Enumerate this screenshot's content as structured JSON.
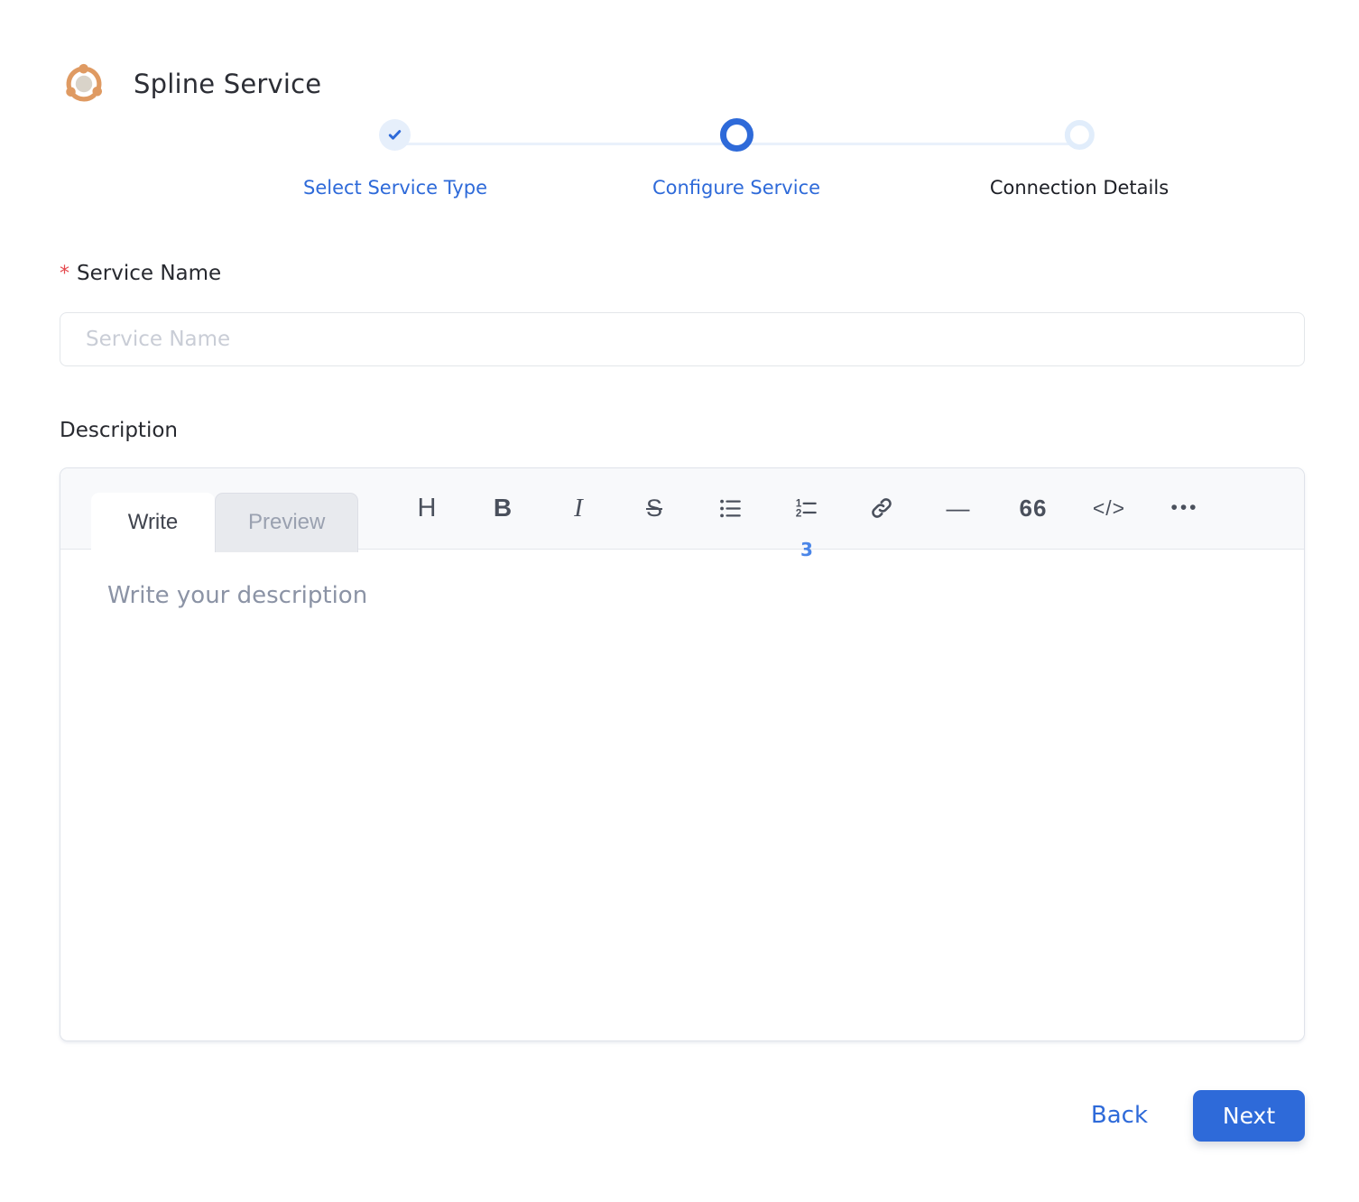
{
  "header": {
    "title": "Spline Service"
  },
  "stepper": {
    "steps": [
      {
        "label": "Select Service Type",
        "state": "completed"
      },
      {
        "label": "Configure Service",
        "state": "active"
      },
      {
        "label": "Connection Details",
        "state": "upcoming"
      }
    ]
  },
  "form": {
    "service_name": {
      "label": "Service Name",
      "required_marker": "*",
      "placeholder": "Service Name",
      "value": ""
    },
    "description": {
      "label": "Description"
    }
  },
  "editor": {
    "tabs": [
      {
        "label": "Write"
      },
      {
        "label": "Preview"
      }
    ],
    "active_tab": "Write",
    "toolbar": [
      {
        "name": "heading",
        "glyph": "H"
      },
      {
        "name": "bold",
        "glyph": "B"
      },
      {
        "name": "italic",
        "glyph": "I"
      },
      {
        "name": "strikethrough",
        "glyph": "S"
      },
      {
        "name": "unordered-list",
        "glyph": ""
      },
      {
        "name": "ordered-list",
        "glyph": ""
      },
      {
        "name": "link",
        "glyph": ""
      },
      {
        "name": "horizontal-rule",
        "glyph": "—"
      },
      {
        "name": "quote",
        "glyph": "66"
      },
      {
        "name": "code",
        "glyph": "</>"
      },
      {
        "name": "more",
        "glyph": "•••"
      }
    ],
    "clipped_badge": "3",
    "placeholder": "Write your description",
    "value": ""
  },
  "footer": {
    "back_label": "Back",
    "next_label": "Next"
  },
  "colors": {
    "accent_blue": "#2e6ad9",
    "step_circle_bg": "#e6effb",
    "upcoming_ring": "#e1edfb",
    "connector_line": "#e9f1fb",
    "logo_orange": "#df9a62",
    "logo_center": "#d9d3c9",
    "required_red": "#e5484d",
    "editor_header_bg": "#f8f9fb",
    "border_gray": "#e3e6ea",
    "toolbar_icon": "#4a505c"
  }
}
